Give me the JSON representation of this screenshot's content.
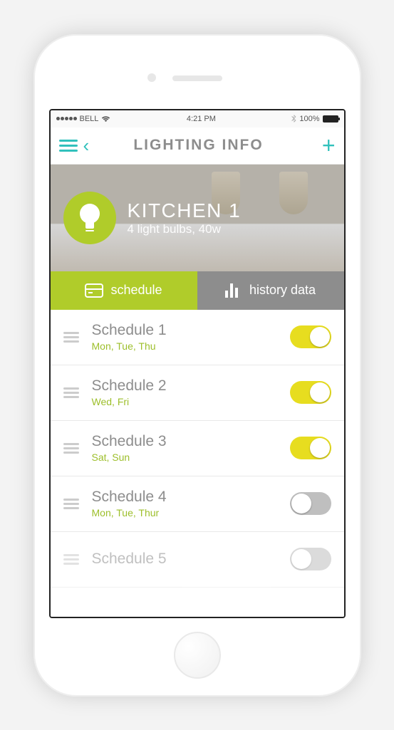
{
  "status": {
    "carrier": "BELL",
    "time": "4:21 PM",
    "battery": "100%"
  },
  "nav": {
    "title": "LIGHTING INFO"
  },
  "hero": {
    "title": "KITCHEN 1",
    "subtitle": "4 light bulbs, 40w"
  },
  "tabs": {
    "schedule": "schedule",
    "history": "history data"
  },
  "schedules": [
    {
      "title": "Schedule 1",
      "days": "Mon, Tue, Thu",
      "on": true
    },
    {
      "title": "Schedule 2",
      "days": "Wed, Fri",
      "on": true
    },
    {
      "title": "Schedule 3",
      "days": "Sat, Sun",
      "on": true
    },
    {
      "title": "Schedule 4",
      "days": "Mon, Tue, Thur",
      "on": false
    },
    {
      "title": "Schedule 5",
      "days": "",
      "on": false
    }
  ]
}
